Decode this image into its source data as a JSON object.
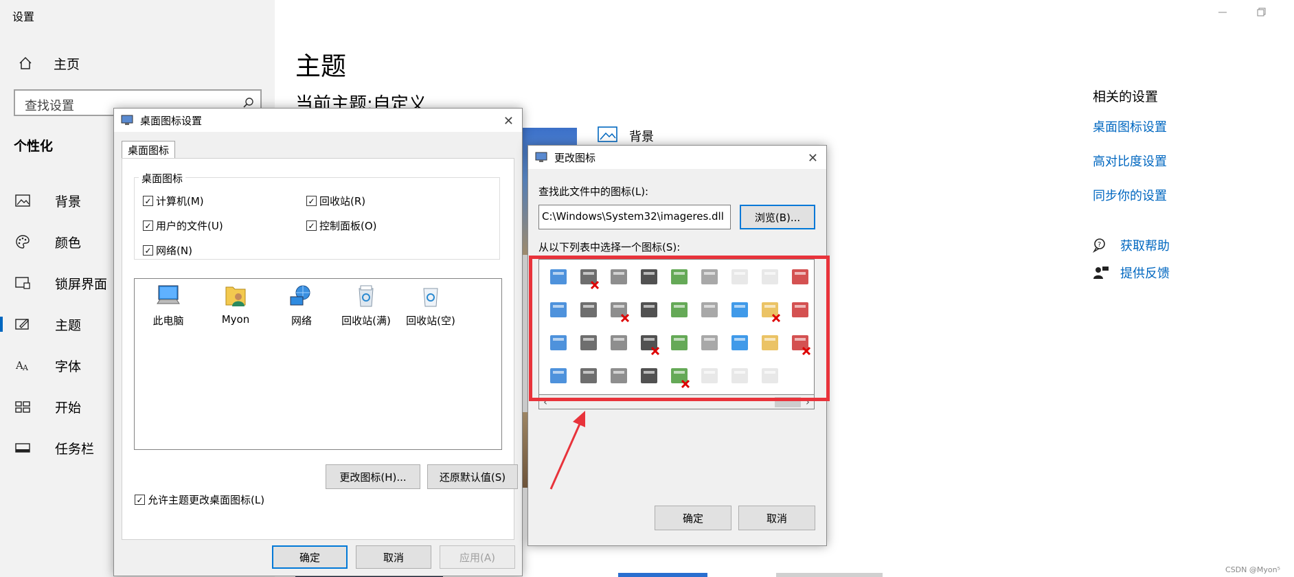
{
  "settings": {
    "window_title": "设置",
    "home_label": "主页",
    "search_placeholder": "查找设置",
    "section_title": "个性化",
    "nav_items": [
      {
        "label": "背景",
        "icon": "picture-icon"
      },
      {
        "label": "颜色",
        "icon": "palette-icon"
      },
      {
        "label": "锁屏界面",
        "icon": "lock-screen-icon"
      },
      {
        "label": "主题",
        "icon": "theme-icon",
        "active": true
      },
      {
        "label": "字体",
        "icon": "font-icon"
      },
      {
        "label": "开始",
        "icon": "start-icon"
      },
      {
        "label": "任务栏",
        "icon": "taskbar-icon"
      }
    ],
    "page_title": "主题",
    "current_theme": "当前主题:自定义",
    "background_label": "背景",
    "related_title": "相关的设置",
    "related_links": [
      "桌面图标设置",
      "高对比度设置",
      "同步你的设置"
    ],
    "help_label": "获取帮助",
    "feedback_label": "提供反馈"
  },
  "desktop_icon_dialog": {
    "title": "桌面图标设置",
    "tab_label": "桌面图标",
    "group_label": "桌面图标",
    "checkboxes": [
      {
        "label": "计算机(M)",
        "checked": true
      },
      {
        "label": "回收站(R)",
        "checked": true
      },
      {
        "label": "用户的文件(U)",
        "checked": true
      },
      {
        "label": "控制面板(O)",
        "checked": true
      },
      {
        "label": "网络(N)",
        "checked": true
      }
    ],
    "icons": [
      "此电脑",
      "Myon",
      "网络",
      "回收站(满)",
      "回收站(空)"
    ],
    "change_icon_button": "更改图标(H)...",
    "restore_default_button": "还原默认值(S)",
    "allow_theme_checkbox": "允许主题更改桌面图标(L)",
    "allow_theme_checked": true,
    "ok_button": "确定",
    "cancel_button": "取消",
    "apply_button": "应用(A)"
  },
  "change_icon_dialog": {
    "title": "更改图标",
    "find_label": "查找此文件中的图标(L):",
    "path_value": "C:\\Windows\\System32\\imageres.dll",
    "browse_button": "浏览(B)...",
    "select_label": "从以下列表中选择一个图标(S):",
    "ok_button": "确定",
    "cancel_button": "取消",
    "icon_grid_columns": 9,
    "icon_grid_count": 35
  },
  "colors": {
    "accent": "#0067c0",
    "highlight_box": "#e8333b",
    "dialog_bg": "#f0f0f0"
  },
  "watermark": "CSDN @Myon⁵"
}
